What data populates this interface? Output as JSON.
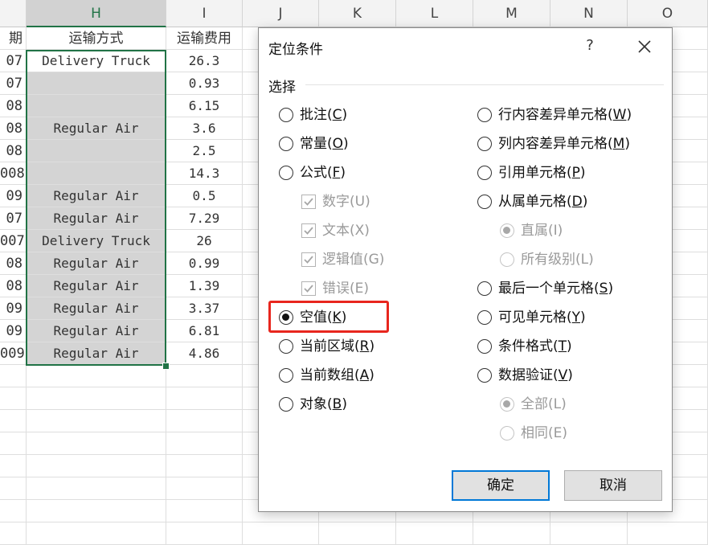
{
  "sheet": {
    "column_headers": [
      "H",
      "I",
      "J",
      "K",
      "L",
      "M",
      "N",
      "O"
    ],
    "active_column": "H",
    "header_row": {
      "g": "期",
      "h": "运输方式",
      "i": "运输费用"
    },
    "rows": [
      {
        "g": "07",
        "h": "Delivery Truck",
        "i": "26.3"
      },
      {
        "g": "07",
        "h": "",
        "i": "0.93"
      },
      {
        "g": "08",
        "h": "",
        "i": "6.15"
      },
      {
        "g": "08",
        "h": "Regular Air",
        "i": "3.6"
      },
      {
        "g": "08",
        "h": "",
        "i": "2.5"
      },
      {
        "g": "008",
        "h": "",
        "i": "14.3"
      },
      {
        "g": "09",
        "h": "Regular Air",
        "i": "0.5"
      },
      {
        "g": "07",
        "h": "Regular Air",
        "i": "7.29"
      },
      {
        "g": "007",
        "h": "Delivery Truck",
        "i": "26"
      },
      {
        "g": "08",
        "h": "Regular Air",
        "i": "0.99"
      },
      {
        "g": "08",
        "h": "Regular Air",
        "i": "1.39"
      },
      {
        "g": "09",
        "h": "Regular Air",
        "i": "3.37"
      },
      {
        "g": "09",
        "h": "Regular Air",
        "i": "6.81"
      },
      {
        "g": "009",
        "h": "Regular Air",
        "i": "4.86"
      }
    ],
    "selection_color": "#217346"
  },
  "dialog": {
    "title": "定位条件",
    "help": "?",
    "close_icon": "close-icon",
    "group_label": "选择",
    "left_options": [
      {
        "text": "批注(",
        "key": "C",
        "tail": ")",
        "kind": "radio",
        "checked": false,
        "disabled": false,
        "indent": false
      },
      {
        "text": "常量(",
        "key": "O",
        "tail": ")",
        "kind": "radio",
        "checked": false,
        "disabled": false,
        "indent": false
      },
      {
        "text": "公式(",
        "key": "F",
        "tail": ")",
        "kind": "radio",
        "checked": false,
        "disabled": false,
        "indent": false
      },
      {
        "text": "数字(U)",
        "key": "",
        "tail": "",
        "kind": "check",
        "checked": true,
        "disabled": true,
        "indent": true
      },
      {
        "text": "文本(X)",
        "key": "",
        "tail": "",
        "kind": "check",
        "checked": true,
        "disabled": true,
        "indent": true
      },
      {
        "text": "逻辑值(G)",
        "key": "",
        "tail": "",
        "kind": "check",
        "checked": true,
        "disabled": true,
        "indent": true
      },
      {
        "text": "错误(E)",
        "key": "",
        "tail": "",
        "kind": "check",
        "checked": true,
        "disabled": true,
        "indent": true
      },
      {
        "text": "空值(",
        "key": "K",
        "tail": ")",
        "kind": "radio",
        "checked": true,
        "disabled": false,
        "indent": false
      },
      {
        "text": "当前区域(",
        "key": "R",
        "tail": ")",
        "kind": "radio",
        "checked": false,
        "disabled": false,
        "indent": false
      },
      {
        "text": "当前数组(",
        "key": "A",
        "tail": ")",
        "kind": "radio",
        "checked": false,
        "disabled": false,
        "indent": false
      },
      {
        "text": "对象(",
        "key": "B",
        "tail": ")",
        "kind": "radio",
        "checked": false,
        "disabled": false,
        "indent": false
      }
    ],
    "right_options": [
      {
        "text": "行内容差异单元格(",
        "key": "W",
        "tail": ")",
        "kind": "radio",
        "checked": false,
        "disabled": false,
        "indent": false
      },
      {
        "text": "列内容差异单元格(",
        "key": "M",
        "tail": ")",
        "kind": "radio",
        "checked": false,
        "disabled": false,
        "indent": false
      },
      {
        "text": "引用单元格(",
        "key": "P",
        "tail": ")",
        "kind": "radio",
        "checked": false,
        "disabled": false,
        "indent": false
      },
      {
        "text": "从属单元格(",
        "key": "D",
        "tail": ")",
        "kind": "radio",
        "checked": false,
        "disabled": false,
        "indent": false
      },
      {
        "text": "直属(I)",
        "key": "",
        "tail": "",
        "kind": "radio",
        "checked": true,
        "disabled": true,
        "indent": true
      },
      {
        "text": "所有级别(L)",
        "key": "",
        "tail": "",
        "kind": "radio",
        "checked": false,
        "disabled": true,
        "indent": true
      },
      {
        "text": "最后一个单元格(",
        "key": "S",
        "tail": ")",
        "kind": "radio",
        "checked": false,
        "disabled": false,
        "indent": false
      },
      {
        "text": "可见单元格(",
        "key": "Y",
        "tail": ")",
        "kind": "radio",
        "checked": false,
        "disabled": false,
        "indent": false
      },
      {
        "text": "条件格式(",
        "key": "T",
        "tail": ")",
        "kind": "radio",
        "checked": false,
        "disabled": false,
        "indent": false
      },
      {
        "text": "数据验证(",
        "key": "V",
        "tail": ")",
        "kind": "radio",
        "checked": false,
        "disabled": false,
        "indent": false
      },
      {
        "text": "全部(L)",
        "key": "",
        "tail": "",
        "kind": "radio",
        "checked": true,
        "disabled": true,
        "indent": true
      },
      {
        "text": "相同(E)",
        "key": "",
        "tail": "",
        "kind": "radio",
        "checked": false,
        "disabled": true,
        "indent": true
      }
    ],
    "ok_label": "确定",
    "cancel_label": "取消",
    "highlight_color": "#e8261e",
    "accent_color": "#0078d7"
  }
}
